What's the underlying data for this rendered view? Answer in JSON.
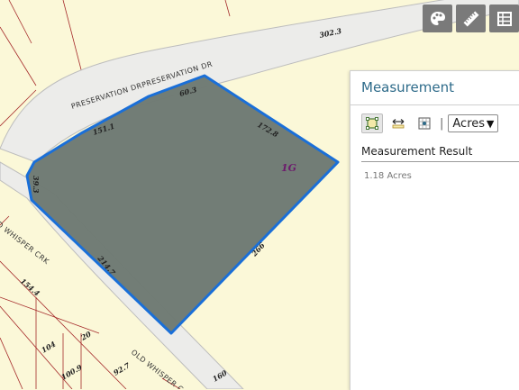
{
  "map": {
    "street_top": "PRESERVATION DRPRESERVATION DR",
    "street_bottom": "OLD WHISPER C",
    "street_left": "D WHISPER CRK",
    "lot_id": "1G",
    "dimensions": [
      "302.3",
      "60.3",
      "151.1",
      "172.8",
      "39.3",
      "214.7",
      "266",
      "154.4",
      "104",
      "20",
      "100.9",
      "92.7",
      "160"
    ]
  },
  "toolbar": {
    "items": [
      {
        "icon": "palette-icon"
      },
      {
        "icon": "ruler-icon"
      },
      {
        "icon": "grid-icon"
      }
    ]
  },
  "panel": {
    "title": "Measurement",
    "tools": [
      {
        "icon": "area-measure-icon",
        "active": true
      },
      {
        "icon": "distance-measure-icon",
        "active": false
      },
      {
        "icon": "location-measure-icon",
        "active": false
      }
    ],
    "separator": "|",
    "unit": "Acres",
    "result_label": "Measurement Result",
    "result_value": "1.18 Acres"
  },
  "colors": {
    "map_background": "#fbf8d8",
    "road": "#ececea",
    "parcel_fill": "#6f7a73",
    "parcel_outline": "#1a6fd8",
    "lot_label": "#6d1a6d",
    "panel_title": "#2e6b8a"
  }
}
